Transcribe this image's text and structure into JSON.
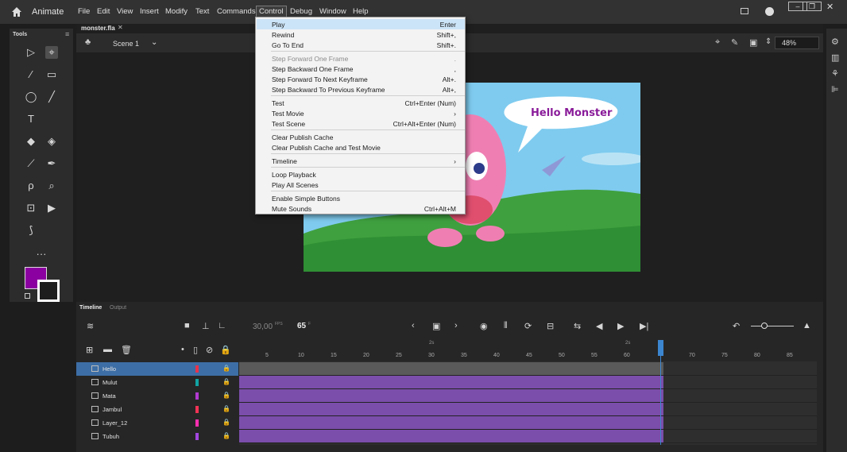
{
  "app": {
    "name": "Animate"
  },
  "menubar": {
    "items": [
      "File",
      "Edit",
      "View",
      "Insert",
      "Modify",
      "Text",
      "Commands",
      "Control",
      "Debug",
      "Window",
      "Help"
    ]
  },
  "tools_panel": {
    "title": "Tools"
  },
  "document": {
    "tab": "monster.fla",
    "scene": "Scene 1",
    "zoom": "48%"
  },
  "stage": {
    "speech_text": "Hello Monster"
  },
  "control_menu": {
    "items": [
      {
        "label": "Play",
        "shortcut": "Enter"
      },
      {
        "label": "Rewind",
        "shortcut": "Shift+,"
      },
      {
        "label": "Go To End",
        "shortcut": "Shift+."
      },
      {
        "label": "Step Forward One Frame",
        "shortcut": "."
      },
      {
        "label": "Step Backward One Frame",
        "shortcut": ","
      },
      {
        "label": "Step Forward To Next Keyframe",
        "shortcut": "Alt+."
      },
      {
        "label": "Step Backward To Previous Keyframe",
        "shortcut": "Alt+,"
      },
      {
        "label": "Test",
        "shortcut": "Ctrl+Enter (Num)"
      },
      {
        "label": "Test Movie",
        "shortcut": "›"
      },
      {
        "label": "Test Scene",
        "shortcut": "Ctrl+Alt+Enter (Num)"
      },
      {
        "label": "Clear Publish Cache",
        "shortcut": ""
      },
      {
        "label": "Clear Publish Cache and Test Movie",
        "shortcut": ""
      },
      {
        "label": "Timeline",
        "shortcut": "›"
      },
      {
        "label": "Loop Playback",
        "shortcut": ""
      },
      {
        "label": "Play All Scenes",
        "shortcut": ""
      },
      {
        "label": "Enable Simple Buttons",
        "shortcut": ""
      },
      {
        "label": "Mute Sounds",
        "shortcut": "Ctrl+Alt+M"
      }
    ]
  },
  "timeline": {
    "tabs": [
      "Timeline",
      "Output"
    ],
    "fps": "30,00",
    "fps_unit": "FPS",
    "current_frame": "65",
    "frame_unit": "F",
    "second_marks": [
      "2s",
      "2s"
    ],
    "ticks": [
      "5",
      "10",
      "15",
      "20",
      "25",
      "30",
      "35",
      "40",
      "45",
      "50",
      "55",
      "60",
      "70",
      "75",
      "80",
      "85"
    ],
    "layers": [
      {
        "name": "Hello",
        "color": "#e8334a"
      },
      {
        "name": "Mulut",
        "color": "#12a3a3"
      },
      {
        "name": "Mata",
        "color": "#b23ad0"
      },
      {
        "name": "Jambul",
        "color": "#f13355"
      },
      {
        "name": "Layer_12",
        "color": "#ff2fb0"
      },
      {
        "name": "Tubuh",
        "color": "#a347e0"
      }
    ]
  },
  "colors": {
    "fill": "#8b00a0",
    "accent": "#3d6ea5",
    "tween": "#7b4eab",
    "playhead": "#3c86d0"
  }
}
